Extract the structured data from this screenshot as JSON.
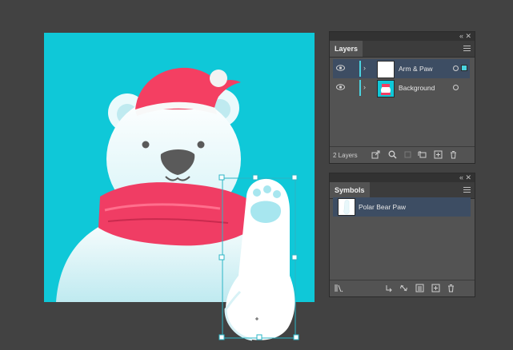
{
  "layers_panel": {
    "tab": "Layers",
    "layers": [
      {
        "name": "Arm & Paw",
        "selected": true
      },
      {
        "name": "Background",
        "selected": false
      }
    ],
    "count_label": "2 Layers",
    "layer_color": "#4ad3e0"
  },
  "symbols_panel": {
    "tab": "Symbols",
    "symbols": [
      {
        "name": "Polar Bear Paw",
        "selected": true
      }
    ]
  },
  "artboard": {
    "background_color": "#0fc8d8",
    "illustration": "polar-bear-with-santa-hat-and-scarf",
    "hat_color": "#f43f62",
    "scarf_color": "#f03d64"
  }
}
